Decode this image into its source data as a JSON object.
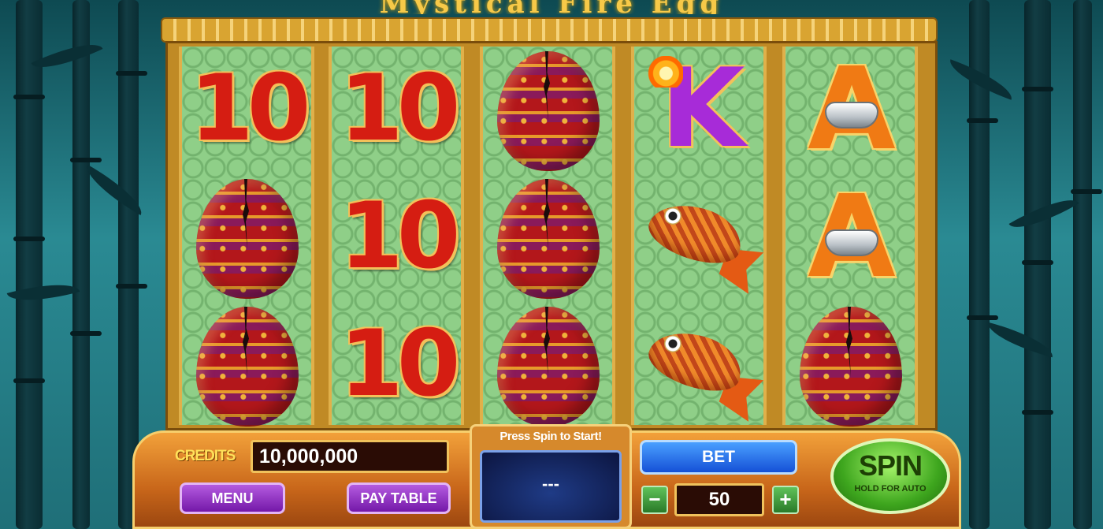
{
  "title": "Mystical Fire Egg",
  "reels": [
    [
      "10",
      "egg",
      "egg"
    ],
    [
      "10",
      "10",
      "10"
    ],
    [
      "egg",
      "egg",
      "egg"
    ],
    [
      "K",
      "fish",
      "fish"
    ],
    [
      "A",
      "A",
      "egg"
    ]
  ],
  "panel": {
    "credits_label": "CREDITS",
    "credits_value": "10,000,000",
    "menu_label": "MENU",
    "paytable_label": "PAY TABLE",
    "status_message": "Press Spin to Start!",
    "win_display": "---",
    "bet_label": "BET",
    "bet_value": "50",
    "minus_label": "−",
    "plus_label": "+",
    "spin_label": "SPIN",
    "spin_sub_label": "HOLD FOR AUTO"
  },
  "colors": {
    "ten": "#d51d12",
    "k": "#a72bd8",
    "a": "#f07a14",
    "spin_green": "#3ea61e",
    "bet_blue": "#1550d6",
    "menu_purple": "#7418a8"
  }
}
